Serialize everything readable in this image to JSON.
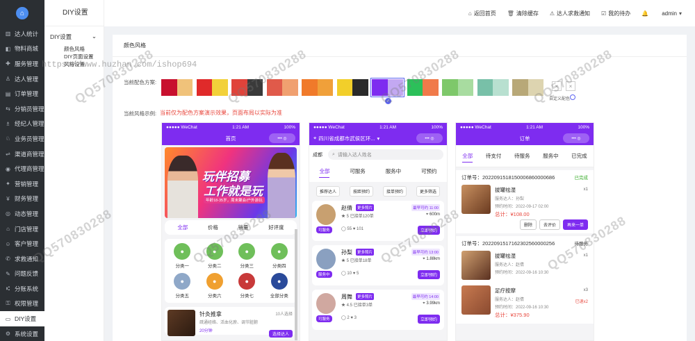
{
  "sidebar": {
    "logo": "⌂",
    "items": [
      {
        "label": "达人统计",
        "icon": "chart-icon"
      },
      {
        "label": "物料商城",
        "icon": "shop-icon"
      },
      {
        "label": "服务管理",
        "icon": "service-icon"
      },
      {
        "label": "达人管理",
        "icon": "user-icon"
      },
      {
        "label": "订单管理",
        "icon": "order-icon"
      },
      {
        "label": "分销员管理",
        "icon": "distributor-icon"
      },
      {
        "label": "经纪人管理",
        "icon": "agent-icon"
      },
      {
        "label": "业务员管理",
        "icon": "salesman-icon"
      },
      {
        "label": "渠道商管理",
        "icon": "channel-icon"
      },
      {
        "label": "代理商管理",
        "icon": "proxy-icon"
      },
      {
        "label": "营销管理",
        "icon": "marketing-icon"
      },
      {
        "label": "财务管理",
        "icon": "finance-icon"
      },
      {
        "label": "动态管理",
        "icon": "dynamic-icon"
      },
      {
        "label": "门店管理",
        "icon": "store-icon"
      },
      {
        "label": "客户管理",
        "icon": "customer-icon"
      },
      {
        "label": "求救通知",
        "icon": "sos-icon"
      },
      {
        "label": "问题反馈",
        "icon": "feedback-icon"
      },
      {
        "label": "分账系统",
        "icon": "split-icon"
      },
      {
        "label": "权限管理",
        "icon": "permission-icon"
      },
      {
        "label": "DIY设置",
        "icon": "diy-icon",
        "active": true
      },
      {
        "label": "系统设置",
        "icon": "settings-icon"
      }
    ]
  },
  "submenu": {
    "title": "DIY设置",
    "group": "DIY设置",
    "items": [
      "颜色风格",
      "DIY页面设置",
      "风格设置"
    ]
  },
  "topbar": {
    "home": "返回首页",
    "clear_cache": "清除缓存",
    "sos": "达人求救通知",
    "todo": "我的待办",
    "user": "admin"
  },
  "main": {
    "title": "颜色风格",
    "current_color_label": "当前配色方案:",
    "custom_label": "自定义配色",
    "style_example_label": "当前风格示例:",
    "style_note": "当前仅为配色方案演示效果，页面布局以实际为准",
    "swatches": [
      [
        "#c8102e",
        "#f0c27a"
      ],
      [
        "#e02a2a",
        "#f2d13a"
      ],
      [
        "#e0433a",
        "#3a3a3a"
      ],
      [
        "#e05a4a",
        "#f0a070"
      ],
      [
        "#f07a2a",
        "#f0a03a"
      ],
      [
        "#f2cf2a",
        "#2a2a2a"
      ],
      [
        "#7e2cf0",
        "#c3a8f2"
      ],
      [
        "#2cc05a",
        "#f07a4a"
      ],
      [
        "#7ec86a",
        "#a8dca0"
      ],
      [
        "#78c0a8",
        "#b8e0d0"
      ],
      [
        "#b8a878",
        "#ddd4b0"
      ]
    ],
    "selected_swatch": 6
  },
  "phone1": {
    "status_left": "●●●●● WeChat",
    "status_time": "1:21 AM",
    "status_right": "100%",
    "title": "首页",
    "banner_t1": "玩伴招募",
    "banner_t2": "工作就是玩",
    "banner_t3": "年龄18-35岁，周末聚会/户外游玩",
    "tabs": [
      "全部",
      "价格",
      "销量",
      "好评度"
    ],
    "cats": [
      {
        "label": "分类一",
        "color": "#6fbf5a",
        "icon": "rocket-icon"
      },
      {
        "label": "分类二",
        "color": "#6fbf5a",
        "icon": "heart-icon"
      },
      {
        "label": "分类三",
        "color": "#6fbf5a",
        "icon": "person-icon"
      },
      {
        "label": "分类四",
        "color": "#6fbf5a",
        "icon": "message-icon"
      },
      {
        "label": "分类五",
        "color": "#8fa8c8",
        "icon": "photo-icon"
      },
      {
        "label": "分类六",
        "color": "#f0a030",
        "icon": "coupon-icon"
      },
      {
        "label": "分类七",
        "color": "#c83a3a",
        "icon": "car-icon"
      },
      {
        "label": "全部分类",
        "color": "#2a4a9a",
        "icon": "grid-icon"
      }
    ],
    "massage_title": "针灸推拿",
    "massage_sub": "疏通经络、活血化瘀、调节脏腑",
    "massage_tag": "10人选择",
    "massage_time": "20分钟",
    "massage_btn": "选择达人"
  },
  "phone2": {
    "status_left": "●●●●● WeChat",
    "status_time": "1:21 AM",
    "status_right": "100%",
    "location": "四川省成都市武侯区环...",
    "city": "成都",
    "search_placeholder": "请输入达人姓名",
    "tabs": [
      "全部",
      "可服务",
      "服务中",
      "可预约"
    ],
    "filters": [
      "推荐达人",
      "按距预约",
      "接单预约",
      "更多筛选"
    ],
    "techs": [
      {
        "name": "赵倩",
        "badge": "更多照片",
        "rating": "5",
        "orders": "已接单120单",
        "earliest": "最早可约 11:00",
        "dist": "600m",
        "comments": "55",
        "likes": "101",
        "status": "可服务",
        "btn": "立即预约",
        "color": "#c8a070"
      },
      {
        "name": "孙梨",
        "badge": "更多照片",
        "rating": "5",
        "orders": "已接单18单",
        "earliest": "最早可约 13:00",
        "dist": "1.88km",
        "comments": "10",
        "likes": "5",
        "status": "服务中",
        "btn": "立即预约",
        "color": "#8aa0c0"
      },
      {
        "name": "周舞",
        "badge": "更多照片",
        "rating": "4.5",
        "orders": "已接单3单",
        "earliest": "最早可约 14:00",
        "dist": "3.99km",
        "comments": "2",
        "likes": "3",
        "status": "可服务",
        "btn": "立即预约",
        "color": "#d0a8a0"
      }
    ]
  },
  "phone3": {
    "status_left": "●●●●● WeChat",
    "status_time": "1:21 AM",
    "status_right": "100%",
    "title": "订单",
    "tabs": [
      "全部",
      "待支付",
      "待服务",
      "服务中",
      "已完成"
    ],
    "orders": [
      {
        "no": "订单号：2022091518150006860000686",
        "status": "已完成",
        "items": [
          {
            "title": "拔罐祛湿",
            "staff": "服务达人：孙梨",
            "time": "预约时间：2022-09-17 02:00",
            "price": "总计：¥108.00",
            "qty": "x1",
            "refund": ""
          }
        ],
        "actions": [
          "删除",
          "去评价",
          "再来一单"
        ]
      },
      {
        "no": "订单号：2022091517162302560000256",
        "status": "待服务",
        "items": [
          {
            "title": "拔罐祛湿",
            "staff": "服务达人：赵倩",
            "time": "预约时间：2022-09-16 10:30",
            "price": "",
            "qty": "x1",
            "refund": ""
          },
          {
            "title": "足疗按摩",
            "staff": "服务达人：赵倩",
            "time": "预约时间：2022-09-16 10:30",
            "price": "总计：¥375.90",
            "qty": "x3",
            "refund": "已退x2"
          }
        ],
        "actions": []
      }
    ]
  },
  "watermark_url": "https://www.huzhan.com/ishop694",
  "watermark_qq": "QQ570830288"
}
